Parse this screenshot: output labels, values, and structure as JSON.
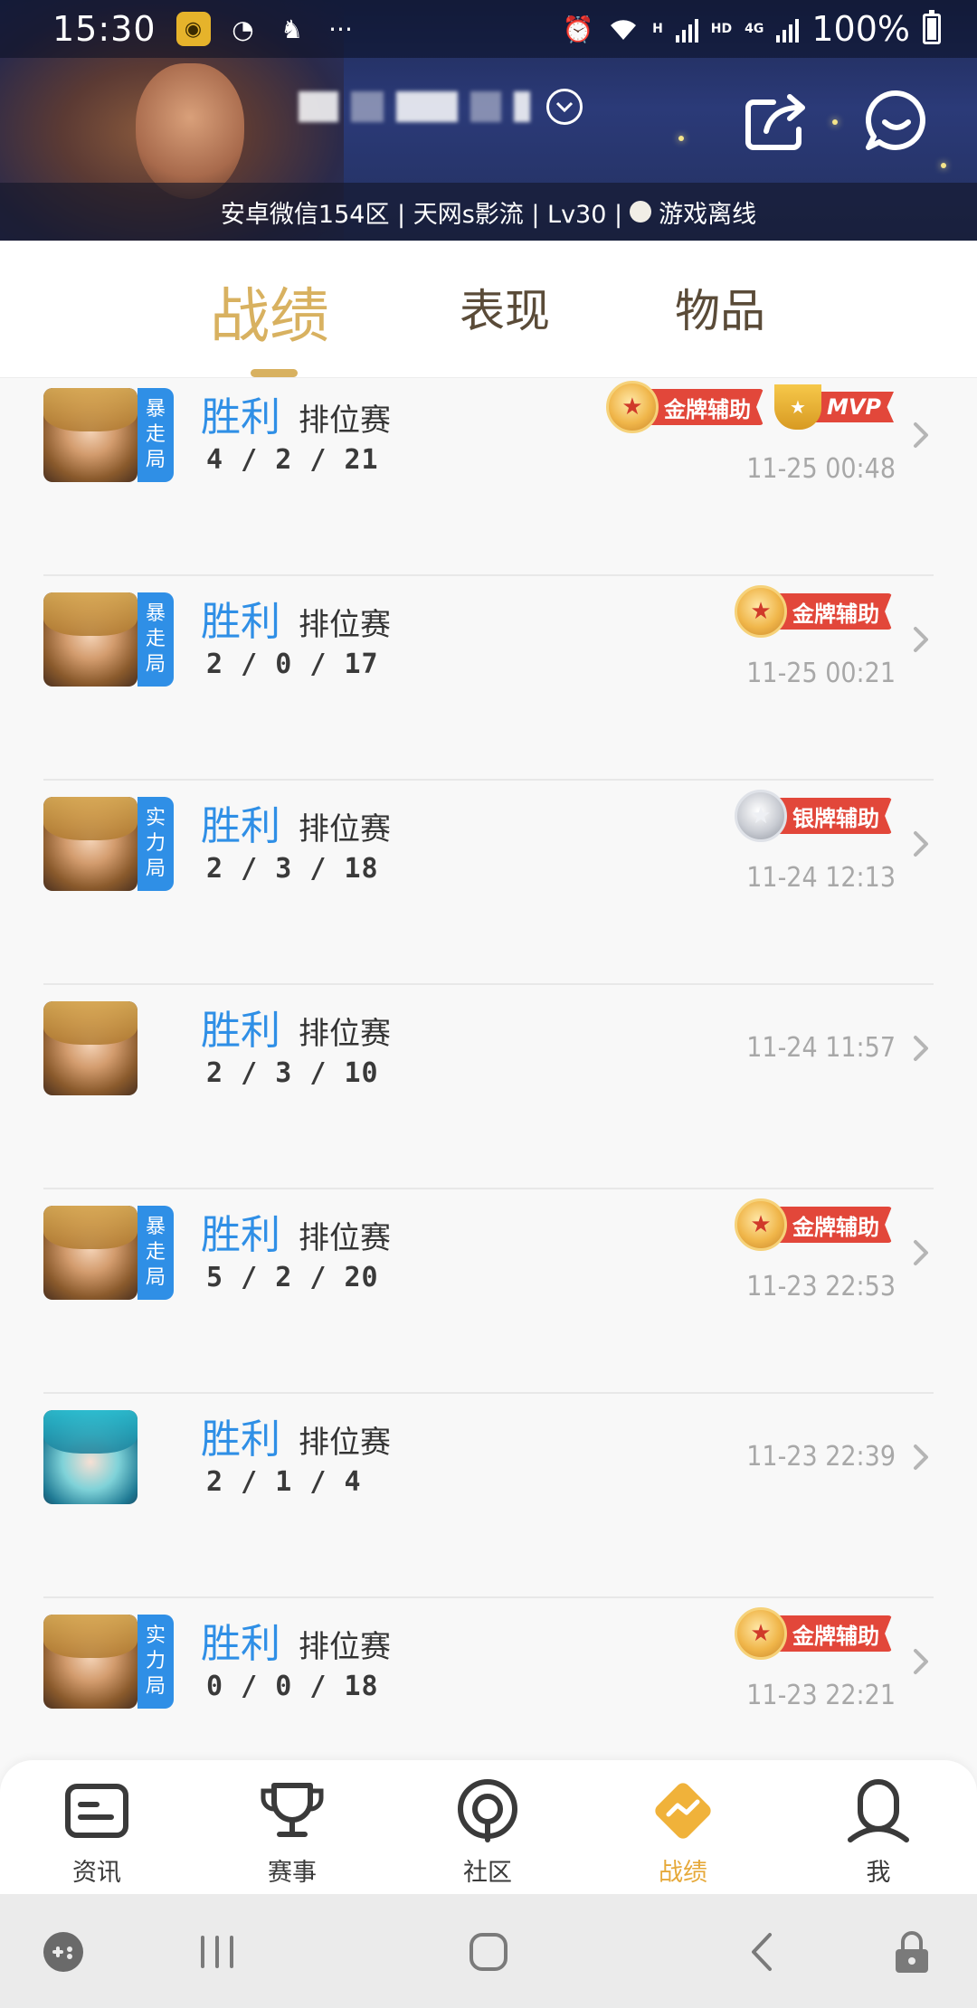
{
  "status_bar": {
    "time": "15:30",
    "network_hd": "HD",
    "network_4g": "4G",
    "network_h": "H",
    "battery_percent": "100%"
  },
  "header": {
    "server_info": "安卓微信154区 | 天网s影流 | Lv30 |",
    "status_text": "游戏离线"
  },
  "tabs": [
    {
      "label": "战绩",
      "active": true
    },
    {
      "label": "表现",
      "active": false
    },
    {
      "label": "物品",
      "active": false
    }
  ],
  "matches": [
    {
      "result": "胜利",
      "type": "排位赛",
      "kda": "4 / 2 / 21",
      "time": "11-25 00:48",
      "mode": "暴走局",
      "award": "金牌辅助",
      "medal": "gold",
      "mvp": "MVP",
      "hero": "gold"
    },
    {
      "result": "胜利",
      "type": "排位赛",
      "kda": "2 / 0 / 17",
      "time": "11-25 00:21",
      "mode": "暴走局",
      "award": "金牌辅助",
      "medal": "gold",
      "mvp": "",
      "hero": "gold"
    },
    {
      "result": "胜利",
      "type": "排位赛",
      "kda": "2 / 3 / 18",
      "time": "11-24 12:13",
      "mode": "实力局",
      "award": "银牌辅助",
      "medal": "silver",
      "mvp": "",
      "hero": "gold"
    },
    {
      "result": "胜利",
      "type": "排位赛",
      "kda": "2 / 3 / 10",
      "time": "11-24 11:57",
      "mode": "",
      "award": "",
      "medal": "",
      "mvp": "",
      "hero": "gold"
    },
    {
      "result": "胜利",
      "type": "排位赛",
      "kda": "5 / 2 / 20",
      "time": "11-23 22:53",
      "mode": "暴走局",
      "award": "金牌辅助",
      "medal": "gold",
      "mvp": "",
      "hero": "gold"
    },
    {
      "result": "胜利",
      "type": "排位赛",
      "kda": "2 / 1 / 4",
      "time": "11-23 22:39",
      "mode": "",
      "award": "",
      "medal": "",
      "mvp": "",
      "hero": "blue"
    },
    {
      "result": "胜利",
      "type": "排位赛",
      "kda": "0 / 0 / 18",
      "time": "11-23 22:21",
      "mode": "实力局",
      "award": "金牌辅助",
      "medal": "gold",
      "mvp": "",
      "hero": "gold"
    }
  ],
  "bottom_nav": [
    {
      "label": "资讯",
      "icon": "news-icon",
      "active": false
    },
    {
      "label": "赛事",
      "icon": "trophy-icon",
      "active": false
    },
    {
      "label": "社区",
      "icon": "community-icon",
      "active": false
    },
    {
      "label": "战绩",
      "icon": "stats-icon",
      "active": true
    },
    {
      "label": "我",
      "icon": "profile-icon",
      "active": false
    }
  ],
  "colors": {
    "accent_gold": "#d8b160",
    "result_blue": "#2f8fe6",
    "award_red": "#e2473a",
    "nav_active": "#e6a93a"
  }
}
